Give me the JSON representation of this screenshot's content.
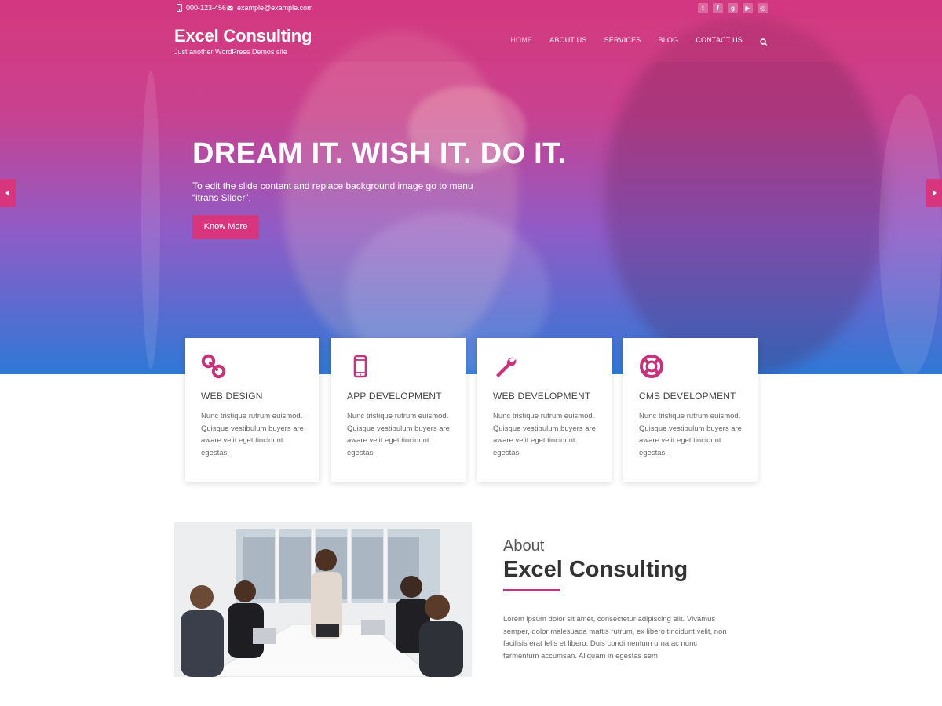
{
  "topbar": {
    "phone": "000-123-456",
    "email": "example@example.com",
    "socials": [
      {
        "icon": "twitter-icon",
        "glyph": "t"
      },
      {
        "icon": "facebook-icon",
        "glyph": "f"
      },
      {
        "icon": "google-plus-icon",
        "glyph": "g"
      },
      {
        "icon": "youtube-icon",
        "glyph": "▶"
      },
      {
        "icon": "instagram-icon",
        "glyph": "◎"
      }
    ]
  },
  "header": {
    "site_title": "Excel Consulting",
    "tagline": "Just another WordPress Demos site",
    "menu": [
      "HOME",
      "ABOUT US",
      "SERVICES",
      "BLOG",
      "CONTACT US"
    ],
    "active_menu": "HOME"
  },
  "hero": {
    "title": "DREAM IT. WISH IT. DO IT.",
    "text": "To edit the slide content and replace background image go to menu “itrans Slider”.",
    "button": "Know More"
  },
  "services": [
    {
      "title": "WEB DESIGN",
      "icon": "link-icon",
      "text": "Nunc tristique rutrum euismod. Quisque vestibulum buyers are aware velit eget tincidunt egestas."
    },
    {
      "title": "APP DEVELOPMENT",
      "icon": "mobile-icon",
      "text": "Nunc tristique rutrum euismod. Quisque vestibulum buyers are aware velit eget tincidunt egestas."
    },
    {
      "title": "WEB DEVELOPMENT",
      "icon": "wrench-icon",
      "text": "Nunc tristique rutrum euismod. Quisque vestibulum buyers are aware velit eget tincidunt egestas."
    },
    {
      "title": "CMS DEVELOPMENT",
      "icon": "life-ring-icon",
      "text": "Nunc tristique rutrum euismod. Quisque vestibulum buyers are aware velit eget tincidunt egestas."
    }
  ],
  "about": {
    "label": "About",
    "heading": "Excel Consulting",
    "text": "Lorem ipsum dolor sit amet, consectetur adipiscing elit. Vivamus semper, dolor malesuada mattis rutrum, ex libero tincidunt velit, non facilisis erat felis et libero. Duis condimentum urna ac nunc fermentum accumsan. Aliquam in egestas sem."
  },
  "colors": {
    "accent": "#d9357e",
    "gradient_top": "#d9397f",
    "gradient_bottom": "#2f78d6"
  }
}
